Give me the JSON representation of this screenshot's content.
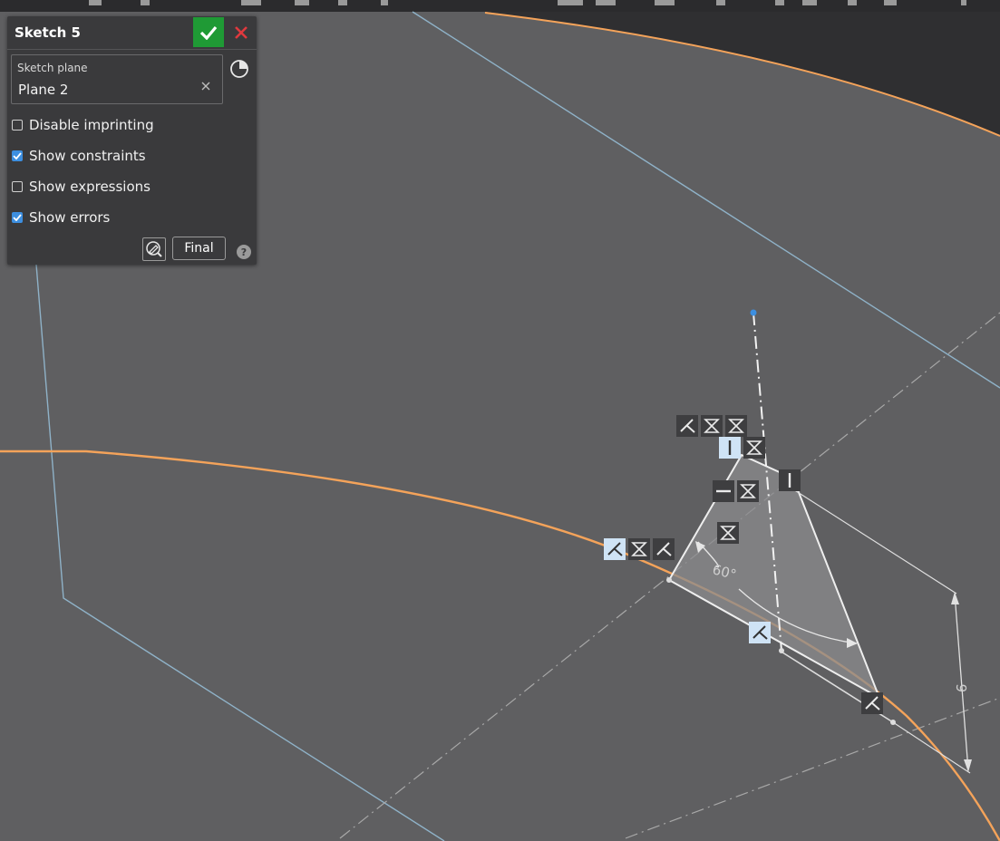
{
  "panel": {
    "title": "Sketch 5",
    "sketch_plane_label": "Sketch plane",
    "sketch_plane_value": "Plane 2",
    "options": [
      {
        "label": "Disable imprinting",
        "checked": false
      },
      {
        "label": "Show constraints",
        "checked": true
      },
      {
        "label": "Show expressions",
        "checked": false
      },
      {
        "label": "Show errors",
        "checked": true
      }
    ],
    "final_label": "Final",
    "help_label": "?"
  },
  "sketch": {
    "angle_dimension": "60°",
    "linear_dimension": "6"
  },
  "colors": {
    "background": "#5f5f61",
    "panel": "#3a3a3c",
    "accept": "#1f9a35",
    "cancel": "#e0393e",
    "checkbox": "#3d8fe0",
    "edge_highlight": "#f4a35a",
    "plane_edge": "#8fb2c8"
  }
}
